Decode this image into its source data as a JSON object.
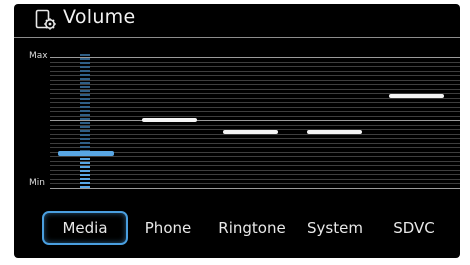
{
  "header": {
    "title": "Volume",
    "icon": "volume-settings-icon"
  },
  "axis": {
    "max_label": "Max",
    "min_label": "Min"
  },
  "sliders": [
    {
      "name": "Media",
      "level": 0.27
    },
    {
      "name": "Phone",
      "level": 0.52
    },
    {
      "name": "Ringtone",
      "level": 0.43
    },
    {
      "name": "System",
      "level": 0.43
    },
    {
      "name": "SDVC",
      "level": 0.7
    }
  ],
  "tabs": [
    {
      "label": "Media",
      "active": true
    },
    {
      "label": "Phone",
      "active": false
    },
    {
      "label": "Ringtone",
      "active": false
    },
    {
      "label": "System",
      "active": false
    },
    {
      "label": "SDVC",
      "active": false
    }
  ],
  "colors": {
    "accent": "#58a6e4",
    "inactive_level": "#f4f4f4",
    "background": "#000000"
  }
}
